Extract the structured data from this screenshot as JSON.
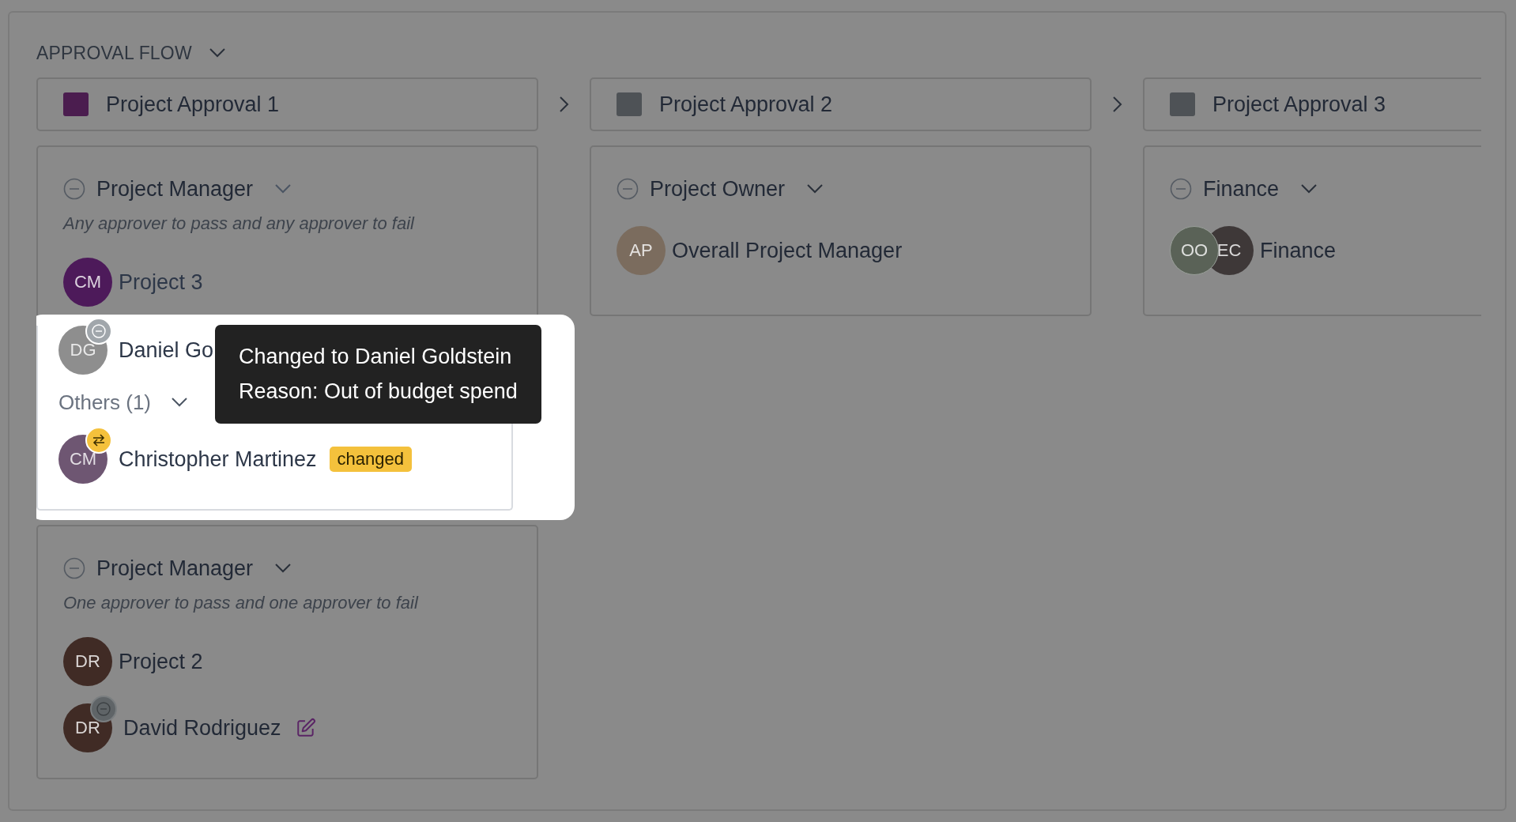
{
  "header": {
    "title": "APPROVAL FLOW",
    "expanded": true
  },
  "stages": [
    {
      "title": "Project Approval 1",
      "color": "#4b1d4f",
      "steps": [
        {
          "role": "Project Manager",
          "rule": "Any approver to pass and any approver to fail",
          "approvers": [
            {
              "name": "Project 3",
              "avatars": [
                {
                  "initials": "CM",
                  "color": "#4d1a5a"
                }
              ]
            }
          ],
          "spotlight": {
            "approvers": [
              {
                "name": "Daniel Go",
                "badge": {
                  "kind": "removed"
                },
                "avatars": [
                  {
                    "initials": "DG",
                    "color": "#8e8e8e"
                  }
                ]
              }
            ],
            "others": {
              "label": "Others (1)",
              "expanded": true,
              "approvers": [
                {
                  "name": "Christopher Martinez",
                  "badge": {
                    "kind": "swapped"
                  },
                  "tag": "changed",
                  "avatars": [
                    {
                      "initials": "CM",
                      "color": "#6e5672"
                    }
                  ]
                }
              ]
            },
            "tooltip": [
              "Changed to Daniel Goldstein",
              "Reason: Out of budget spend"
            ]
          }
        },
        {
          "role": "Project Manager",
          "rule": "One approver to pass and one approver to fail",
          "approvers": [
            {
              "name": "Project 2",
              "avatars": [
                {
                  "initials": "DR",
                  "color": "#402b25"
                }
              ]
            },
            {
              "name": "David Rodriguez",
              "badge": {
                "kind": "removed"
              },
              "editable": true,
              "avatars": [
                {
                  "initials": "DR",
                  "color": "#402b25"
                }
              ]
            }
          ]
        }
      ]
    },
    {
      "title": "Project Approval 2",
      "color": "#4e5256",
      "steps": [
        {
          "role": "Project Owner",
          "approvers": [
            {
              "name": "Overall Project Manager",
              "avatars": [
                {
                  "initials": "AP",
                  "color": "#7b6c5e"
                }
              ]
            }
          ]
        }
      ]
    },
    {
      "title": "Project Approval 3",
      "color": "#4e5256",
      "steps": [
        {
          "role": "Finance",
          "approvers": [
            {
              "name": "Finance",
              "avatars": [
                {
                  "initials": "OO",
                  "color": "#5a6257"
                },
                {
                  "initials": "EC",
                  "color": "#3e3838"
                }
              ]
            }
          ]
        }
      ]
    }
  ]
}
